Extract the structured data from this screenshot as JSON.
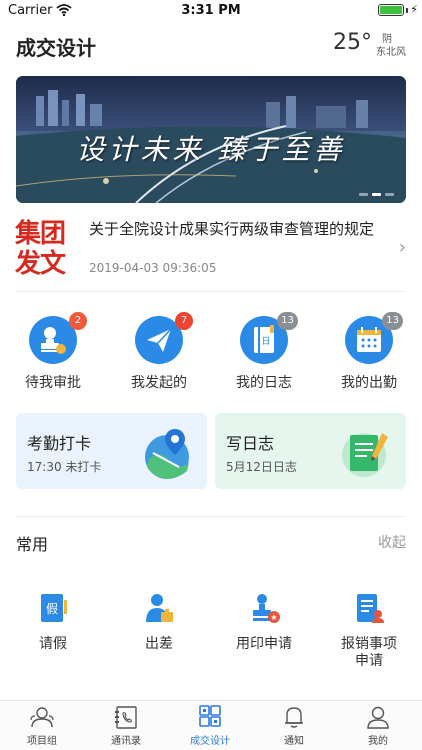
{
  "status_bar": {
    "carrier": "Carrier",
    "time": "3:31 PM",
    "battery_level": 1.0
  },
  "header": {
    "title": "成交设计",
    "weather": {
      "temperature": "25°",
      "condition": "阴",
      "wind": "东北风"
    }
  },
  "banner": {
    "slogan": "设计未来 臻于至善",
    "slide_count": 3,
    "active_slide": 1
  },
  "news": {
    "logo_line1": "集团",
    "logo_line2": "发文",
    "title": "关于全院设计成果实行两级审查管理的规定",
    "date": "2019-04-03 09:36:05"
  },
  "quick_actions": [
    {
      "label": "待我审批",
      "icon": "approval-icon",
      "badge": "2",
      "badge_color": "#ee5a3a"
    },
    {
      "label": "我发起的",
      "icon": "paper-plane-icon",
      "badge": "7",
      "badge_color": "#ee4430"
    },
    {
      "label": "我的日志",
      "icon": "log-book-icon",
      "badge": "13",
      "badge_color": "#8a8f96"
    },
    {
      "label": "我的出勤",
      "icon": "calendar-icon",
      "badge": "13",
      "badge_color": "#8a8f96"
    }
  ],
  "cards": {
    "checkin": {
      "title": "考勤打卡",
      "subtitle": "17:30 未打卡"
    },
    "log": {
      "title": "写日志",
      "subtitle": "5月12日日志"
    }
  },
  "common": {
    "title": "常用",
    "collapse_label": "收起",
    "items": [
      {
        "label": "请假",
        "icon": "leave-icon",
        "icon_text": "假"
      },
      {
        "label": "出差",
        "icon": "business-trip-icon"
      },
      {
        "label": "用印申请",
        "icon": "seal-request-icon"
      },
      {
        "label": "报销事项申请",
        "label_line1": "报销事项",
        "label_line2": "申请",
        "icon": "reimbursement-icon"
      }
    ]
  },
  "tabs": [
    {
      "label": "项目组",
      "icon": "group-icon",
      "active": false
    },
    {
      "label": "通讯录",
      "icon": "contacts-icon",
      "active": false
    },
    {
      "label": "成交设计",
      "icon": "grid-icon",
      "active": true
    },
    {
      "label": "通知",
      "icon": "bell-icon",
      "active": false
    },
    {
      "label": "我的",
      "icon": "profile-icon",
      "active": false
    }
  ],
  "colors": {
    "accent": "#2b7be0",
    "icon_blue": "#2b8ae6",
    "logo_red": "#d42a1f",
    "checkin_card_bg": "#e9f2fd",
    "log_card_bg": "#e5f6ee"
  }
}
